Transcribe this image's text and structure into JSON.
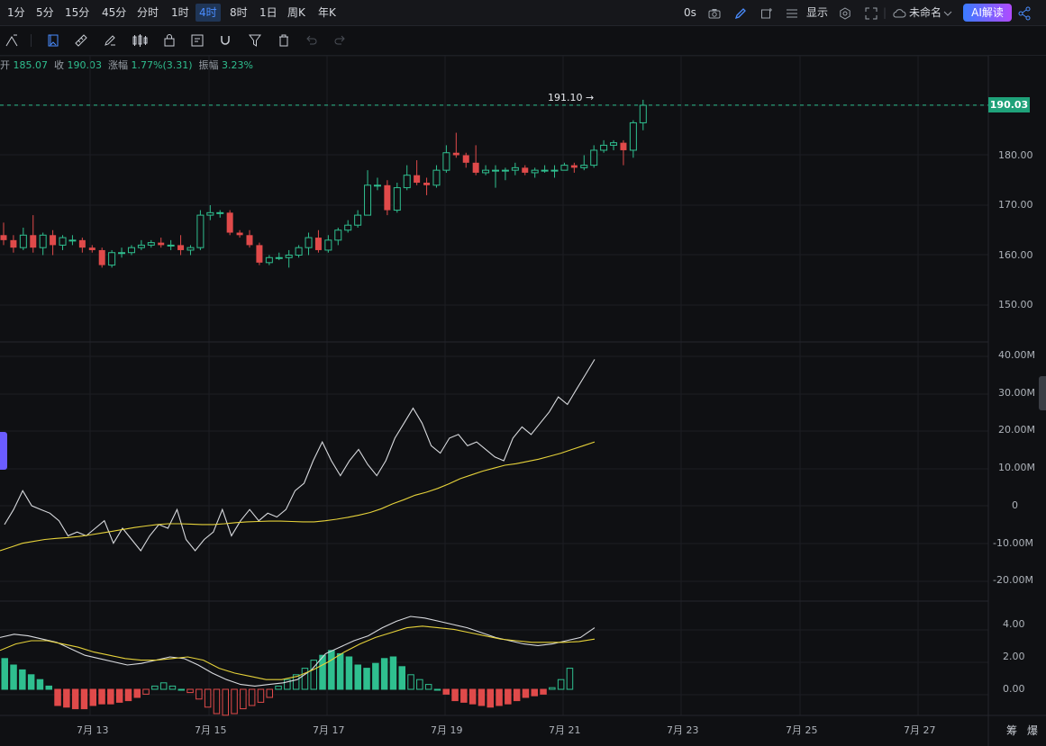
{
  "timeframes": [
    {
      "label": "1分",
      "active": false
    },
    {
      "label": "5分",
      "active": false
    },
    {
      "label": "15分",
      "active": false
    },
    {
      "label": "45分",
      "active": false
    },
    {
      "label": "分时",
      "active": false
    },
    {
      "label": "1时",
      "active": false
    },
    {
      "label": "4时",
      "active": true
    },
    {
      "label": "8时",
      "active": false
    },
    {
      "label": "1日",
      "active": false
    },
    {
      "label": "周K",
      "active": false
    },
    {
      "label": "年K",
      "active": false
    }
  ],
  "topright": {
    "countdown": "0s",
    "display_label": "显示",
    "layout_name": "未命名",
    "ai_button": "AI解读"
  },
  "info_line": {
    "open_label": "开",
    "open_value": "185.07",
    "close_label": "收",
    "close_value": "190.03",
    "change_label": "涨幅",
    "change_value": "1.77%(3.31)",
    "amp_label": "振幅",
    "amp_value": "3.23%"
  },
  "price_tag": "190.03",
  "high_label": "191.10 →",
  "price_axis": [
    "190.00",
    "180.00",
    "170.00",
    "160.00",
    "150.00"
  ],
  "volume_axis": [
    "40.00M",
    "30.00M",
    "20.00M",
    "10.00M",
    "0",
    "-10.00M",
    "-20.00M"
  ],
  "macd_axis": [
    "4.00",
    "2.00",
    "0.00"
  ],
  "date_axis": [
    "7月 13",
    "7月 15",
    "7月 17",
    "7月 19",
    "7月 21",
    "7月 23",
    "7月 25",
    "7月 27"
  ],
  "bottom_right": {
    "chip": "筹",
    "burst": "爆"
  },
  "colors": {
    "up": "#2fbf8f",
    "down": "#e04a4a",
    "bg": "#0f1013",
    "accent": "#4a8dff",
    "ma_yellow": "#e6d23a"
  },
  "chart_data": {
    "type": "candlestick",
    "ylim": [
      145,
      195
    ],
    "candles": [
      [
        164.0,
        163.0,
        166.5,
        162.0
      ],
      [
        163.0,
        161.5,
        164.0,
        160.5
      ],
      [
        161.5,
        164.0,
        165.5,
        161.0
      ],
      [
        164.0,
        161.5,
        168.0,
        160.5
      ],
      [
        161.5,
        164.0,
        164.5,
        160.0
      ],
      [
        164.0,
        162.0,
        165.0,
        160.0
      ],
      [
        162.0,
        163.5,
        164.0,
        161.0
      ],
      [
        163.0,
        163.0,
        164.0,
        162.0
      ],
      [
        163.0,
        161.5,
        163.5,
        160.5
      ],
      [
        161.5,
        161.0,
        162.0,
        160.5
      ],
      [
        161.0,
        158.0,
        161.5,
        157.5
      ],
      [
        158.0,
        160.5,
        161.0,
        157.5
      ],
      [
        160.5,
        160.5,
        161.5,
        159.5
      ],
      [
        160.5,
        161.5,
        162.0,
        160.0
      ],
      [
        161.5,
        162.0,
        163.0,
        161.0
      ],
      [
        162.0,
        162.5,
        163.0,
        161.5
      ],
      [
        162.5,
        162.0,
        163.5,
        161.5
      ],
      [
        162.0,
        162.0,
        163.0,
        161.0
      ],
      [
        162.0,
        161.0,
        164.0,
        160.0
      ],
      [
        161.0,
        161.5,
        162.0,
        160.0
      ],
      [
        161.5,
        168.0,
        169.0,
        161.0
      ],
      [
        168.0,
        168.5,
        170.0,
        167.0
      ],
      [
        168.5,
        168.5,
        169.0,
        167.5
      ],
      [
        168.5,
        164.5,
        169.0,
        164.0
      ],
      [
        164.5,
        164.0,
        165.0,
        163.5
      ],
      [
        164.0,
        162.0,
        165.0,
        161.5
      ],
      [
        162.0,
        158.5,
        162.5,
        158.0
      ],
      [
        158.5,
        159.5,
        160.0,
        158.0
      ],
      [
        159.5,
        159.5,
        160.5,
        159.0
      ],
      [
        159.5,
        160.0,
        161.0,
        157.5
      ],
      [
        160.0,
        161.5,
        162.0,
        159.5
      ],
      [
        161.5,
        163.5,
        164.5,
        160.0
      ],
      [
        163.5,
        161.0,
        165.0,
        160.5
      ],
      [
        161.0,
        163.0,
        164.0,
        160.5
      ],
      [
        163.0,
        165.0,
        165.5,
        162.0
      ],
      [
        165.0,
        166.0,
        167.0,
        164.5
      ],
      [
        166.0,
        168.0,
        169.0,
        165.5
      ],
      [
        168.0,
        174.0,
        177.0,
        168.0
      ],
      [
        174.0,
        174.0,
        175.5,
        173.0
      ],
      [
        174.0,
        169.0,
        175.0,
        168.0
      ],
      [
        169.0,
        173.5,
        174.5,
        168.5
      ],
      [
        173.5,
        176.0,
        178.0,
        173.0
      ],
      [
        176.0,
        174.5,
        179.0,
        174.0
      ],
      [
        174.5,
        174.0,
        175.5,
        172.0
      ],
      [
        174.0,
        177.0,
        178.0,
        173.5
      ],
      [
        177.0,
        180.5,
        182.0,
        176.5
      ],
      [
        180.5,
        180.0,
        184.5,
        179.5
      ],
      [
        180.0,
        178.5,
        180.5,
        177.5
      ],
      [
        178.5,
        176.5,
        182.0,
        176.0
      ],
      [
        176.5,
        177.0,
        178.0,
        176.0
      ],
      [
        177.0,
        177.0,
        178.0,
        173.5
      ],
      [
        177.0,
        177.0,
        177.5,
        175.0
      ],
      [
        177.0,
        177.5,
        178.5,
        176.0
      ],
      [
        177.5,
        176.5,
        178.0,
        176.0
      ],
      [
        176.5,
        177.0,
        177.5,
        175.5
      ],
      [
        177.0,
        177.0,
        178.0,
        176.5
      ],
      [
        177.0,
        177.0,
        178.0,
        175.5
      ],
      [
        177.0,
        178.0,
        178.5,
        177.0
      ],
      [
        178.0,
        177.5,
        178.5,
        176.5
      ],
      [
        177.5,
        178.0,
        180.0,
        177.0
      ],
      [
        178.0,
        181.0,
        182.0,
        177.5
      ],
      [
        181.0,
        182.0,
        183.0,
        180.5
      ],
      [
        182.0,
        182.5,
        183.0,
        181.0
      ],
      [
        182.5,
        181.0,
        183.0,
        178.0
      ],
      [
        181.0,
        186.5,
        187.0,
        179.5
      ],
      [
        186.5,
        190.0,
        191.1,
        185.0
      ]
    ]
  }
}
